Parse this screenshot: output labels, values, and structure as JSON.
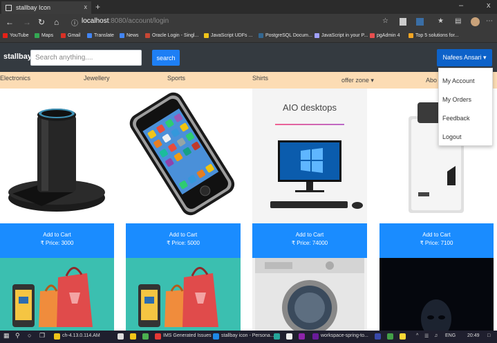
{
  "browser": {
    "tab_title": "stallbay Icon",
    "tab_close": "x",
    "new_tab": "+",
    "url_host": "localhost",
    "url_path": ":8080/account/login",
    "window_minimize": "–",
    "window_close": "x"
  },
  "bookmarks": [
    {
      "label": "YouTube",
      "color": "#e62117"
    },
    {
      "label": "Maps",
      "color": "#34a853"
    },
    {
      "label": "Gmail",
      "color": "#d93025"
    },
    {
      "label": "Translate",
      "color": "#4285f4"
    },
    {
      "label": "News",
      "color": "#4285f4"
    },
    {
      "label": "Oracle Login - Singl...",
      "color": "#c74634"
    },
    {
      "label": "JavaScript UDFs ...",
      "color": "#f0c419"
    },
    {
      "label": "PostgreSQL Docum...",
      "color": "#336791"
    },
    {
      "label": "JavaScript in your P...",
      "color": "#a0a0ff"
    },
    {
      "label": "pgAdmin 4",
      "color": "#e84e4e"
    },
    {
      "label": "Top 5 solutions for...",
      "color": "#f5a623"
    }
  ],
  "site": {
    "logo": "stallbay",
    "search_placeholder": "Search anything....",
    "search_button": "search",
    "user_button": "Nafees Ansari",
    "caret": "▾"
  },
  "categories": {
    "electronics": "Electronics",
    "jewellery": "Jewellery",
    "sports": "Sports",
    "shirts": "Shirts",
    "offer_zone": "offer zone",
    "offer_caret": "▾",
    "partial": "Abo"
  },
  "dropdown": [
    "My Account",
    "My Orders",
    "Feedback",
    "Logout"
  ],
  "products": [
    {
      "add": "Add to Cart",
      "price": "₹ Price: 3000"
    },
    {
      "add": "Add to Cart",
      "price": "₹ Price: 5000"
    },
    {
      "add": "Add to Cart",
      "price": "₹ Price: 74000",
      "image_text": "AIO desktops"
    },
    {
      "add": "Add to Cart",
      "price": "₹ Price: 7100"
    }
  ],
  "taskbar": {
    "items": [
      "ch-4.13.0.114.AM",
      "IMS Generated Issues ...",
      "stallbay icon - Persona...",
      "workspace-spring-to..."
    ],
    "tray": "ENG",
    "time": "20:49"
  },
  "colors": {
    "navbar": "#343a40",
    "accent_blue": "#1a8cff",
    "category_bar": "#fcdcb4"
  }
}
